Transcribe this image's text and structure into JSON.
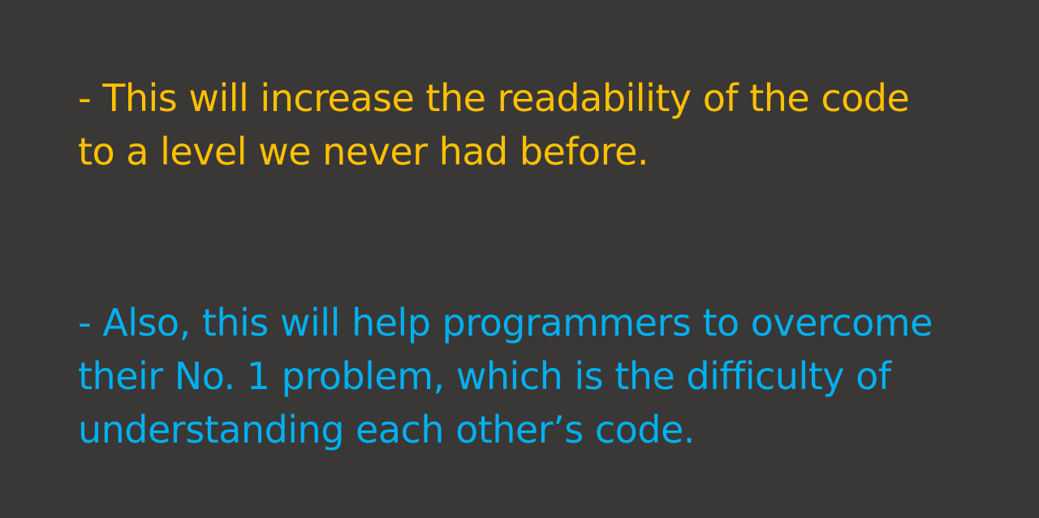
{
  "slide": {
    "paragraphs": [
      {
        "color": "#ffc000",
        "lines": [
          "- This will increase the readability of the code",
          "to a level we never had before."
        ]
      },
      {
        "color": "#00b0f0",
        "lines": [
          "- Also, this will help programmers to overcome",
          "their No. 1 problem, which is the difficulty of",
          "understanding each other’s code."
        ]
      }
    ],
    "background_color": "#3a3836"
  }
}
